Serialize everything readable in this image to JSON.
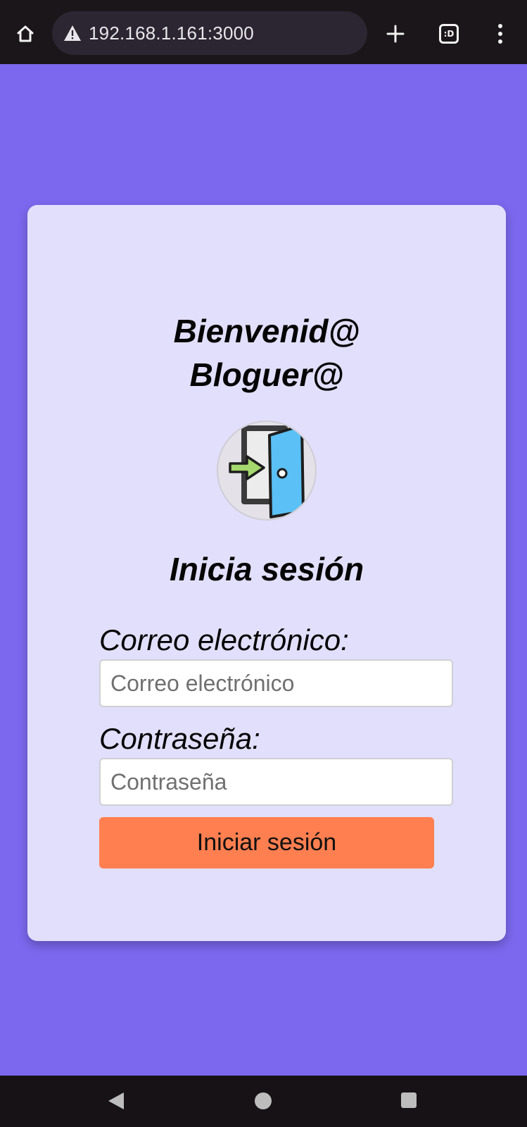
{
  "browser": {
    "url": "192.168.1.161:3000",
    "icons": {
      "home": "home-icon",
      "warning": "not-secure-warning-icon",
      "new_tab": "plus-icon",
      "tabs": "tab-switcher-icon",
      "menu": "more-vert-icon"
    },
    "tab_switcher_glyph": ":D"
  },
  "login_card": {
    "welcome_line1": "Bienvenid@",
    "welcome_line2": "Bloguer@",
    "illustration": "login-door-icon",
    "title": "Inicia sesión",
    "email_label": "Correo electrónico:",
    "email_placeholder": "Correo electrónico",
    "email_value": "",
    "password_label": "Contraseña:",
    "password_placeholder": "Contraseña",
    "password_value": "",
    "submit_label": "Iniciar sesión"
  },
  "android_nav": {
    "back": "back-triangle-icon",
    "home": "home-circle-icon",
    "recent": "recent-apps-square-icon"
  },
  "colors": {
    "page_background": "#7b68ee",
    "card_background": "#e2dffc",
    "button_background": "#ff7f50",
    "browser_bar": "#1a1619",
    "url_box": "#2b2631"
  }
}
